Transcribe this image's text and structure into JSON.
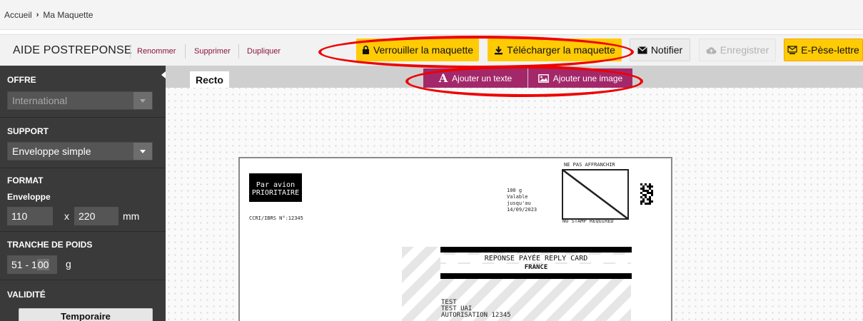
{
  "breadcrumb": {
    "home": "Accueil",
    "current": "Ma Maquette"
  },
  "header": {
    "title": "AIDE POSTREPONSE",
    "links": {
      "rename": "Renommer",
      "delete": "Supprimer",
      "duplicate": "Dupliquer"
    },
    "buttons": {
      "lock": "Verrouiller la maquette",
      "download": "Télécharger la maquette",
      "notify": "Notifier",
      "save": "Enregistrer",
      "elettre": "E-Pèse-lettre"
    }
  },
  "sidebar": {
    "offre": {
      "title": "OFFRE",
      "value": "International"
    },
    "support": {
      "title": "SUPPORT",
      "value": "Enveloppe simple"
    },
    "format": {
      "title": "FORMAT",
      "subtitle": "Enveloppe",
      "width": "110",
      "times": "x",
      "height": "220",
      "unit": "mm"
    },
    "poids": {
      "title": "TRANCHE DE POIDS",
      "range_from": "51 - 1",
      "range_highlight": "00",
      "unit": "g"
    },
    "validite": {
      "title": "VALIDITÉ",
      "button": "Temporaire"
    }
  },
  "canvas": {
    "tab": "Recto",
    "tools": {
      "add_text": "Ajouter un texte",
      "add_image": "Ajouter une image"
    }
  },
  "envelope": {
    "par_avion_line1": "Par avion",
    "par_avion_line2": "PRIORITAIRE",
    "ccri": "CCRI/IBRS N°:12345",
    "weight": "100 g",
    "valid_1": "Valable",
    "valid_2": "jusqu'au",
    "valid_date": "14/09/2023",
    "ne_pas": "NE PAS AFFRANCHIR",
    "no_stamp": "NO STAMP REQUIRED",
    "reponse_title": "REPONSE PAYÉE REPLY CARD",
    "reponse_country": "FRANCE",
    "addr_1": "TEST",
    "addr_2": "TEST UAI",
    "addr_3": "AUTORISATION 12345"
  },
  "colors": {
    "accent_yellow": "#ffcb05",
    "tool_magenta": "#a3286a",
    "link_bordeaux": "#8b1538",
    "annotation_red": "#ee0000",
    "sidebar": "#3a3a3a"
  }
}
